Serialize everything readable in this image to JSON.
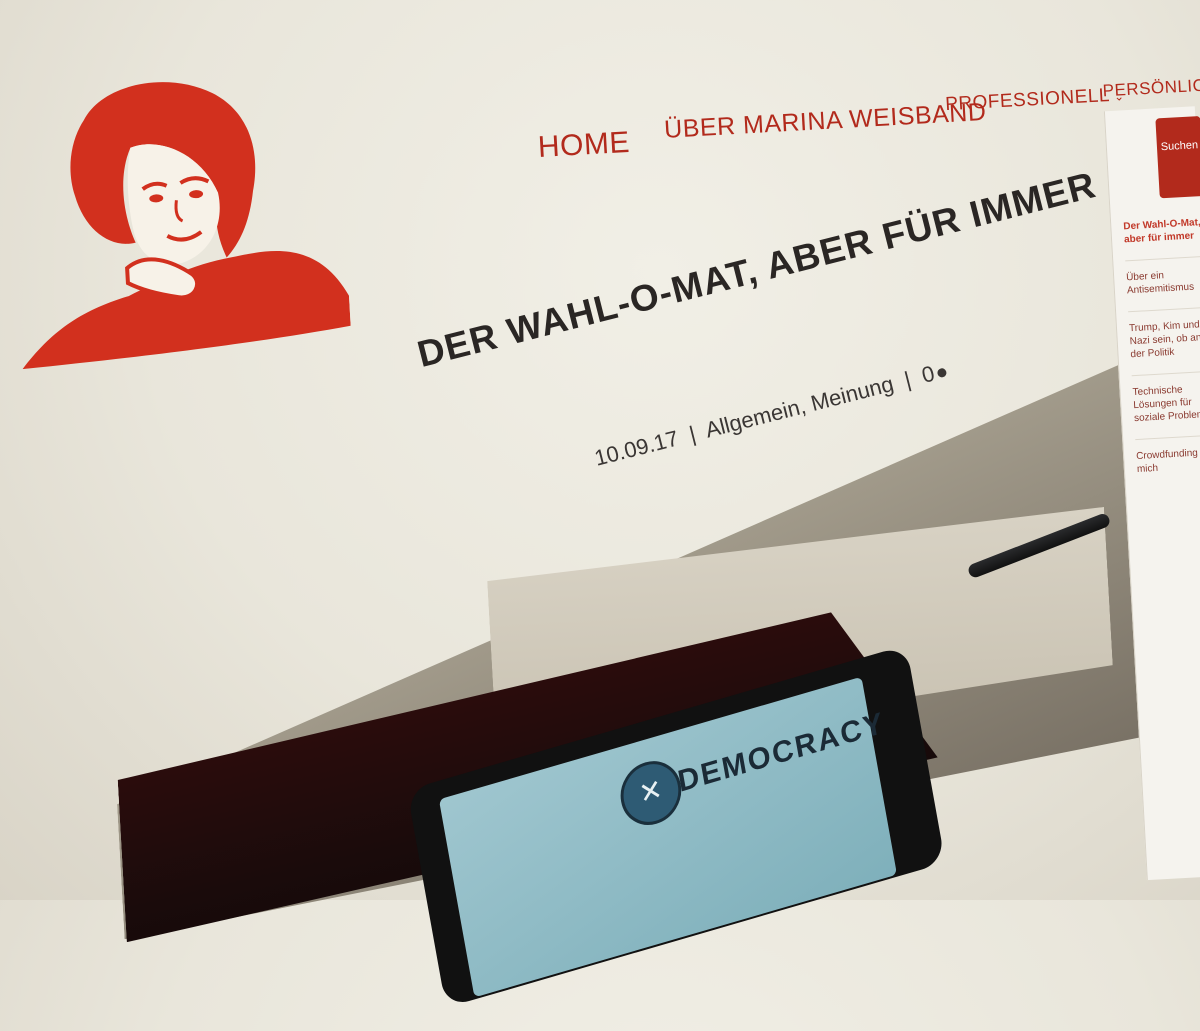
{
  "nav": {
    "items": [
      "HOME",
      "ÜBER MARINA WEISBAND",
      "PROFESSIONELL",
      "PERSÖNLICHES"
    ],
    "professionell_chevron": "chevron-down-icon"
  },
  "post": {
    "title": "DER WAHL-O-MAT, ABER FÜR IMMER",
    "date": "10.09.17",
    "categories": "Allgemein, Meinung",
    "comments": "0"
  },
  "featured_image": {
    "tablet_brand": "DEMOCRACY",
    "tablet_logo_icon": "x-logo-icon"
  },
  "sidebar": {
    "search_button_label": "Suchen",
    "items": [
      "Der Wahl-O-Mat, aber für immer",
      "Über ein Antisemitismus",
      "Trump, Kim und Nazi sein, ob an der Politik",
      "Technische Lösungen für soziale Probleme",
      "Crowdfunding für mich"
    ]
  },
  "colors": {
    "accent": "#b22a1c",
    "title": "#2a2624"
  }
}
